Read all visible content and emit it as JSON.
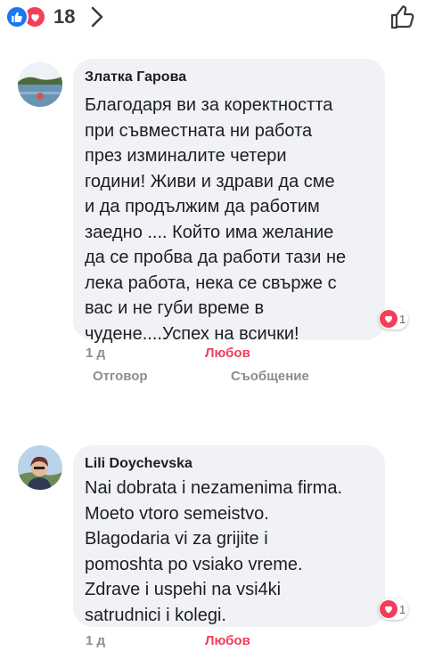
{
  "header": {
    "reaction_count": "18",
    "icons": [
      "like-icon",
      "love-icon",
      "chevron-right-icon",
      "thumbs-up-outline-icon"
    ],
    "colors": {
      "like": "#1877f2",
      "love": "#f33e58",
      "bubble": "#f0f2f5",
      "meta": "#8a8d91"
    }
  },
  "comments": [
    {
      "author": "Златка Гарова",
      "lines": [
        "Благодаря ви за коректността",
        "при съвместната ни работа",
        "през изминалите четери",
        "години! Живи и здрави да сме",
        "и да продължим да работим",
        "заедно .... Който има желание",
        "да се пробва да работи тази не",
        "лека работа, нека се свърже с",
        "вас и не губи време в",
        "чудене....Успех на всички!"
      ],
      "reaction_count": "1",
      "time": "1 д",
      "reaction_label": "Любов",
      "reply_label": "Отговор",
      "message_label": "Съобщение"
    },
    {
      "author": "Lili Doychevska",
      "lines": [
        "Nai dobrata i nezamenima firma.",
        "Moeto vtoro semeistvo.",
        "Blagodaria vi za grijite i",
        "pomoshta po vsiako vreme.",
        "Zdrave i uspehi na vsi4ki",
        "satrudnici i kolegi."
      ],
      "reaction_count": "1",
      "time": "1 д",
      "reaction_label": "Любов"
    }
  ]
}
